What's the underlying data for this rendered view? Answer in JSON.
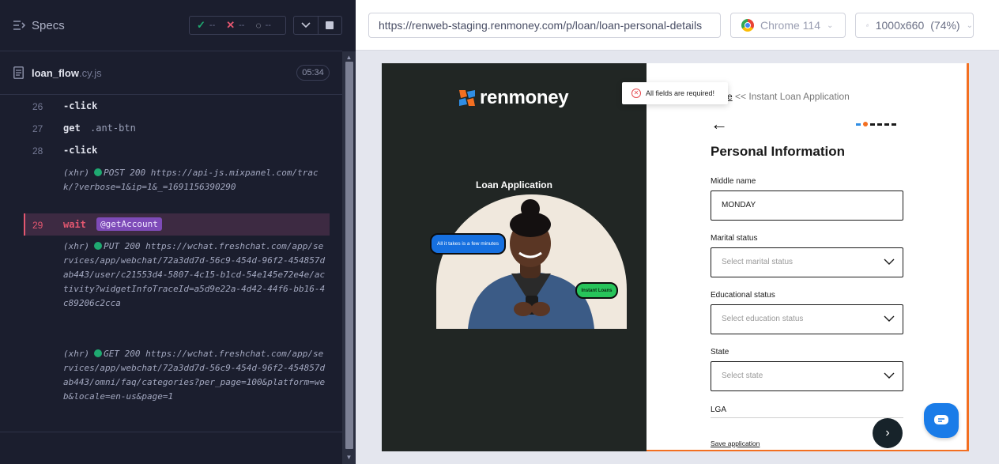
{
  "runner": {
    "title": "Specs",
    "stats": {
      "passed": "--",
      "failed": "--",
      "pending": "--"
    },
    "file": {
      "name": "loan_flow",
      "ext": ".cy.js"
    },
    "timer": "05:34",
    "commands": [
      {
        "num": "26",
        "name": "-click",
        "msg": ""
      },
      {
        "num": "27",
        "name": "get",
        "msg": ".ant-btn"
      },
      {
        "num": "28",
        "name": "-click",
        "msg": ""
      },
      {
        "num": "29",
        "name": "wait",
        "alias": "@getAccount"
      }
    ],
    "xhr": [
      {
        "prefix": "(xhr)",
        "method": "POST 200",
        "url": "https://api-js.mixpanel.com/track/?verbose=1&ip=1&_=1691156390290"
      },
      {
        "prefix": "(xhr)",
        "method": "PUT 200",
        "url": "https://wchat.freshchat.com/app/services/app/webchat/72a3dd7d-56c9-454d-96f2-454857dab443/user/c21553d4-5807-4c15-b1cd-54e145e72e4e/activity?widgetInfoTraceId=a5d9e22a-4d42-44f6-bb16-4c89206c2cca"
      },
      {
        "prefix": "(xhr)",
        "method": "GET 200",
        "url": "https://wchat.freshchat.com/app/services/app/webchat/72a3dd7d-56c9-454d-96f2-454857dab443/omni/faq/categories?per_page=100&platform=web&locale=en-us&page=1"
      }
    ]
  },
  "aut": {
    "url": "https://renweb-staging.renmoney.com/p/loan/loan-personal-details",
    "browser": "Chrome 114",
    "viewport": "1000x660",
    "scale": "(74%)"
  },
  "app": {
    "brand": "renmoney",
    "left_title": "Loan Application",
    "bubble_blue": "All it takes is a few minutes",
    "bubble_green": "Instant Loans",
    "toast": "All fields are required!",
    "crumb_home": "e",
    "crumb_rest": " << Instant Loan Application",
    "page_title": "Personal Information",
    "fields": {
      "middle_name_label": "Middle name",
      "middle_name_value": "MONDAY",
      "marital_label": "Marital status",
      "marital_placeholder": "Select marital status",
      "education_label": "Educational status",
      "education_placeholder": "Select education status",
      "state_label": "State",
      "state_placeholder": "Select state",
      "lga_label": "LGA"
    },
    "save_link": "Save application",
    "colors": {
      "brand_orange": "#f36f21",
      "brand_blue": "#2f8de4",
      "dark_bg": "#212624"
    }
  }
}
